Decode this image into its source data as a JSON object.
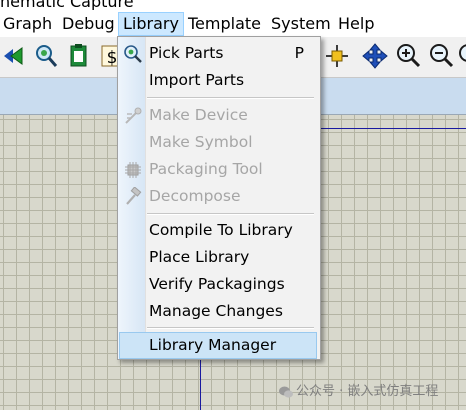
{
  "window": {
    "title": "hematic Capture"
  },
  "menubar": {
    "items": [
      {
        "label": "Graph"
      },
      {
        "label": "Debug"
      },
      {
        "label": "Library"
      },
      {
        "label": "Template"
      },
      {
        "label": "System"
      },
      {
        "label": "Help"
      }
    ],
    "active": "Library"
  },
  "toolbar": {
    "icons": [
      "back-play-icon",
      "magnifier-icon",
      "clipboard-icon",
      "dollar-icon",
      "crosshair-icon",
      "pan-icon",
      "zoom-in-icon",
      "zoom-out-icon",
      "zoom-fit-icon"
    ]
  },
  "library_menu": {
    "items": [
      {
        "label": "Pick Parts",
        "shortcut": "P",
        "icon": "magnifier-icon",
        "disabled": false
      },
      {
        "label": "Import Parts",
        "disabled": false
      },
      {
        "label": "Make Device",
        "icon": "make-device-icon",
        "disabled": true
      },
      {
        "label": "Make Symbol",
        "disabled": true
      },
      {
        "label": "Packaging Tool",
        "icon": "packaging-icon",
        "disabled": true
      },
      {
        "label": "Decompose",
        "icon": "hammer-icon",
        "disabled": true
      },
      {
        "label": "Compile To Library",
        "disabled": false
      },
      {
        "label": "Place Library",
        "disabled": false
      },
      {
        "label": "Verify Packagings",
        "disabled": false
      },
      {
        "label": "Manage Changes",
        "disabled": false
      },
      {
        "label": "Library Manager",
        "disabled": false,
        "highlighted": true
      }
    ]
  },
  "watermark": {
    "text": "公众号 · 嵌入式仿真工程"
  },
  "colors": {
    "accent": "#1a1aa0",
    "menu_highlight": "#cce4f7",
    "grid": "#d8d8cc"
  }
}
